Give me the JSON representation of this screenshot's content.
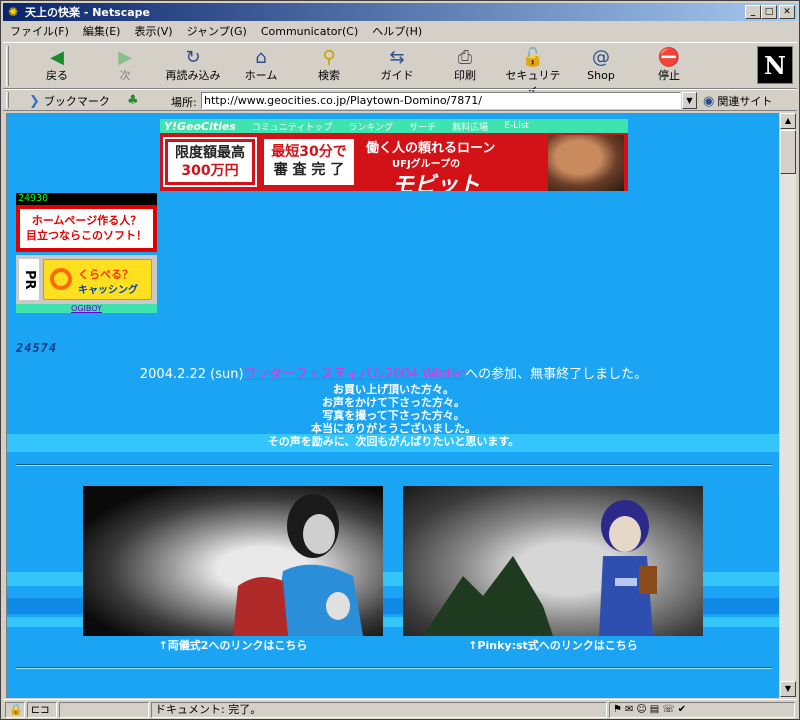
{
  "window": {
    "title": "天上の快楽 - Netscape",
    "icon": "star-burst-icon"
  },
  "menu": [
    "ファイル(F)",
    "編集(E)",
    "表示(V)",
    "ジャンプ(G)",
    "Communicator(C)",
    "ヘルプ(H)"
  ],
  "toolbar": {
    "back": "戻る",
    "forward": "次",
    "reload": "再読み込み",
    "home": "ホーム",
    "search": "検索",
    "guide": "ガイド",
    "print": "印刷",
    "security": "セキュリティ",
    "shop": "Shop",
    "stop": "停止",
    "logo": "N"
  },
  "location": {
    "bookmarks": "ブックマーク",
    "label": "場所:",
    "url": "http://www.geocities.co.jp/Playtown-Domino/7871/",
    "related": "関連サイト"
  },
  "geo": {
    "logo": "Y!GeoCities",
    "links": [
      "コミュニティトップ",
      "ランキング",
      "サーチ",
      "無料広場",
      "E-List"
    ]
  },
  "ad": {
    "box1_l1": "限度額最高",
    "box1_l2": "300万円",
    "box2_l1": "最短30分で",
    "box2_l2": "審 査 完 了",
    "headline": "働く人の頼れるローン",
    "sub": "UFJグループの",
    "main": "モビット"
  },
  "sidebar": {
    "counter1": "24930",
    "hp_ad_l1": "ホームページ作る人？",
    "hp_ad_l2": "目立つならこのソフト！",
    "pr_label": "PR",
    "kurabel_t1": "くらべる？",
    "kurabel_t2": "キャッシング",
    "ogiboy": "OGIBOY",
    "counter2": "24574"
  },
  "news": {
    "date": "2004.2.22 (sun)",
    "event_link": "ワンダーフェスティバル2004 Winter",
    "event_suffix": "への参加、無事終了しました。",
    "lines": [
      "お買い上げ頂いた方々。",
      "お声をかけて下さった方々。",
      "写真を撮って下さった方々。",
      "本当にありがとうございました。",
      "その声を励みに、次回もがんばりたいと思います。"
    ]
  },
  "photos": [
    {
      "caption": "↑両儀式2へのリンクはこちら"
    },
    {
      "caption": "↑Pinky:st式へのリンクはこちら"
    }
  ],
  "status": {
    "text": "ドキュメント: 完了。"
  }
}
